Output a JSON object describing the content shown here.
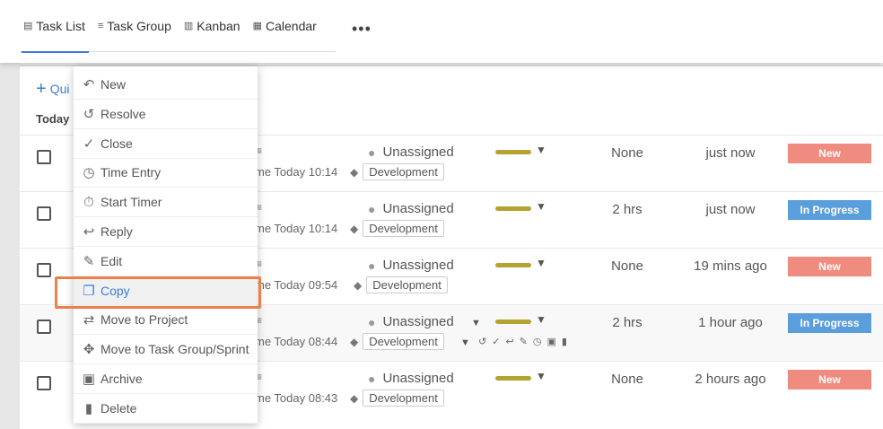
{
  "tabs": [
    {
      "label": "Task List",
      "icon": "list-icon",
      "glyph": "▤",
      "active": true
    },
    {
      "label": "Task Group",
      "icon": "task-group-icon",
      "glyph": "≡"
    },
    {
      "label": "Kanban",
      "icon": "kanban-icon",
      "glyph": "▥"
    },
    {
      "label": "Calendar",
      "icon": "calendar-icon",
      "glyph": "▦"
    }
  ],
  "more_label": "•••",
  "quick_label": "Qui",
  "today_label": "Today",
  "context_menu": [
    {
      "label": "New",
      "icon": "new-icon",
      "glyph": "↶"
    },
    {
      "label": "Resolve",
      "icon": "resolve-icon",
      "glyph": "↺"
    },
    {
      "label": "Close",
      "icon": "check-icon",
      "glyph": "✓"
    },
    {
      "label": "Time Entry",
      "icon": "clock-icon",
      "glyph": "◷"
    },
    {
      "label": "Start Timer",
      "icon": "timer-icon",
      "glyph": "⏱"
    },
    {
      "label": "Reply",
      "icon": "reply-icon",
      "glyph": "↩"
    },
    {
      "label": "Edit",
      "icon": "pencil-icon",
      "glyph": "✎"
    },
    {
      "label": "Copy",
      "icon": "copy-icon",
      "glyph": "❐",
      "selected": true
    },
    {
      "label": "Move to Project",
      "icon": "swap-icon",
      "glyph": "⇄"
    },
    {
      "label": "Move to Task Group/Sprint",
      "icon": "move-icon",
      "glyph": "✥"
    },
    {
      "label": "Archive",
      "icon": "archive-icon",
      "glyph": "▣"
    },
    {
      "label": "Delete",
      "icon": "trash-icon",
      "glyph": "▮"
    }
  ],
  "tasks": [
    {
      "sub": "me Today 10:14",
      "tag": "Development",
      "assignee": "Unassigned",
      "estimate": "None",
      "updated": "just now",
      "status": "New",
      "status_kind": "new"
    },
    {
      "sub": "me Today 10:14",
      "tag": "Development",
      "assignee": "Unassigned",
      "estimate": "2 hrs",
      "updated": "just now",
      "status": "In Progress",
      "status_kind": "prog"
    },
    {
      "sub": "me Today 09:54",
      "tag": "Development",
      "assignee": "Unassigned",
      "estimate": "None",
      "updated": "19 mins ago",
      "status": "New",
      "status_kind": "new"
    },
    {
      "sub": "me Today 08:44",
      "tag": "Development",
      "assignee": "Unassigned",
      "estimate": "2 hrs",
      "updated": "1 hour ago",
      "status": "In Progress",
      "status_kind": "prog"
    },
    {
      "sub": "me Today 08:43",
      "tag": "Development",
      "assignee": "Unassigned",
      "estimate": "None",
      "updated": "2 hours ago",
      "status": "New",
      "status_kind": "new"
    }
  ],
  "row_action_icons": [
    "↺",
    "✓",
    "↩",
    "✎",
    "◷",
    "▣",
    "▮"
  ],
  "colors": {
    "accent": "#3b7dd8",
    "status_new": "#f08b80",
    "status_progress": "#5b9edc",
    "priority": "#b5a233",
    "highlight": "#e8824a"
  }
}
